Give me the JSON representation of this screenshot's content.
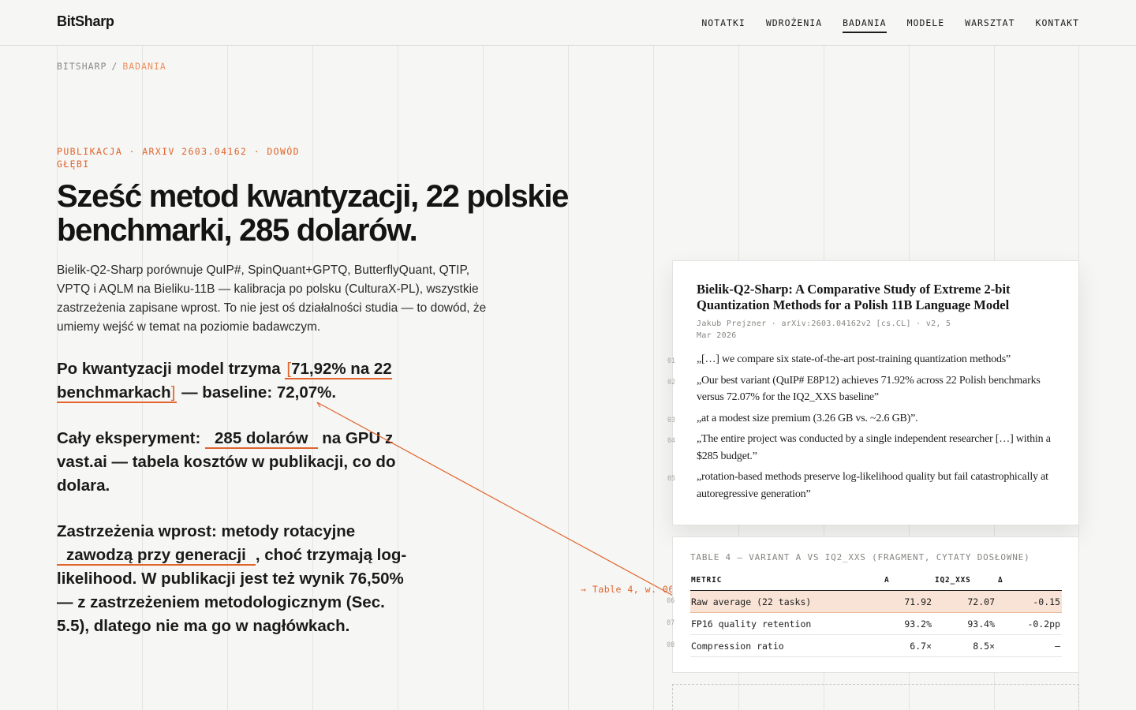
{
  "brand": {
    "name": "BitSharp",
    "accent": "#e0642c"
  },
  "nav": {
    "items": [
      "NOTATKI",
      "WDROŻENIA",
      "BADANIA",
      "MODELE",
      "WARSZTAT",
      "KONTAKT"
    ],
    "active": "BADANIA"
  },
  "breadcrumb": {
    "root": "BITSHARP",
    "separator": "/",
    "current": "BADANIA"
  },
  "article": {
    "eyebrow": "PUBLIKACJA · ARXIV 2603.04162 · DOWÓD GŁĘBI",
    "title": "Sześć metod kwantyzacji, 22 polskie benchmarki, 285 dolarów.",
    "lede": "Bielik-Q2-Sharp porównuje QuIP#, SpinQuant+GPTQ, ButterflyQuant, QTIP, VPTQ i AQLM na Bieliku-11B — kalibracja po polsku (CulturaX-PL), wszystkie zastrzeżenia zapisane wprost. To nie jest oś działalności studia — to dowód, że umiemy wejść w temat na poziomie badawczym.",
    "claims": [
      {
        "before": "Po kwantyzacji model trzyma ",
        "highlight": "71,92% na 22 benchmarkach",
        "after": " — baseline: 72,07%."
      },
      {
        "before": "Cały eksperyment: ",
        "highlight": "285 dolarów",
        "after": " na GPU z vast.ai — tabela kosztów w publikacji, co do dolara."
      },
      {
        "before": "Zastrzeżenia wprost: metody rotacyjne ",
        "highlight": "zawodzą przy generacji",
        "after": ", choć trzymają log-likelihood. W publikacji jest też wynik 76,50% — z zastrzeżeniem metodologicznym (Sec. 5.5), dlatego nie ma go w nagłówkach."
      }
    ],
    "table_ref": "→ Table 4, w. 06"
  },
  "paper": {
    "title": "Bielik-Q2-Sharp: A Comparative Study of Extreme 2-bit Quantization Methods for a Polish 11B Language Model",
    "meta": "Jakub Prejzner · arXiv:2603.04162v2 [cs.CL] · v2, 5 Mar 2026",
    "quotes": [
      {
        "num": "01",
        "text": "„[…] we compare six state-of-the-art post-training quantization methods”"
      },
      {
        "num": "02",
        "text": "„Our best variant (QuIP# E8P12) achieves 71.92% across 22 Polish benchmarks versus 72.07% for the IQ2_XXS baseline”"
      },
      {
        "num": "03",
        "text": "„at a modest size premium (3.26 GB vs. ~2.6 GB)”."
      },
      {
        "num": "04",
        "text": "„The entire project was conducted by a single independent researcher […] within a $285 budget.”"
      },
      {
        "num": "05",
        "text": "„rotation-based methods preserve log-likelihood quality but fail catastrophically at autoregressive generation”"
      }
    ]
  },
  "table": {
    "caption": "TABLE 4 — VARIANT A VS IQ2_XXS (FRAGMENT, CYTATY DOSŁOWNE)",
    "headers": [
      "METRIC",
      "A",
      "IQ2_XXS",
      "Δ"
    ],
    "rows": [
      {
        "num": "06",
        "cells": [
          "Raw average (22 tasks)",
          "71.92",
          "72.07",
          "-0.15"
        ],
        "highlight": true
      },
      {
        "num": "07",
        "cells": [
          "FP16 quality retention",
          "93.2%",
          "93.4%",
          "-0.2pp"
        ],
        "highlight": false
      },
      {
        "num": "08",
        "cells": [
          "Compression ratio",
          "6.7×",
          "8.5×",
          "—"
        ],
        "highlight": false
      }
    ]
  }
}
